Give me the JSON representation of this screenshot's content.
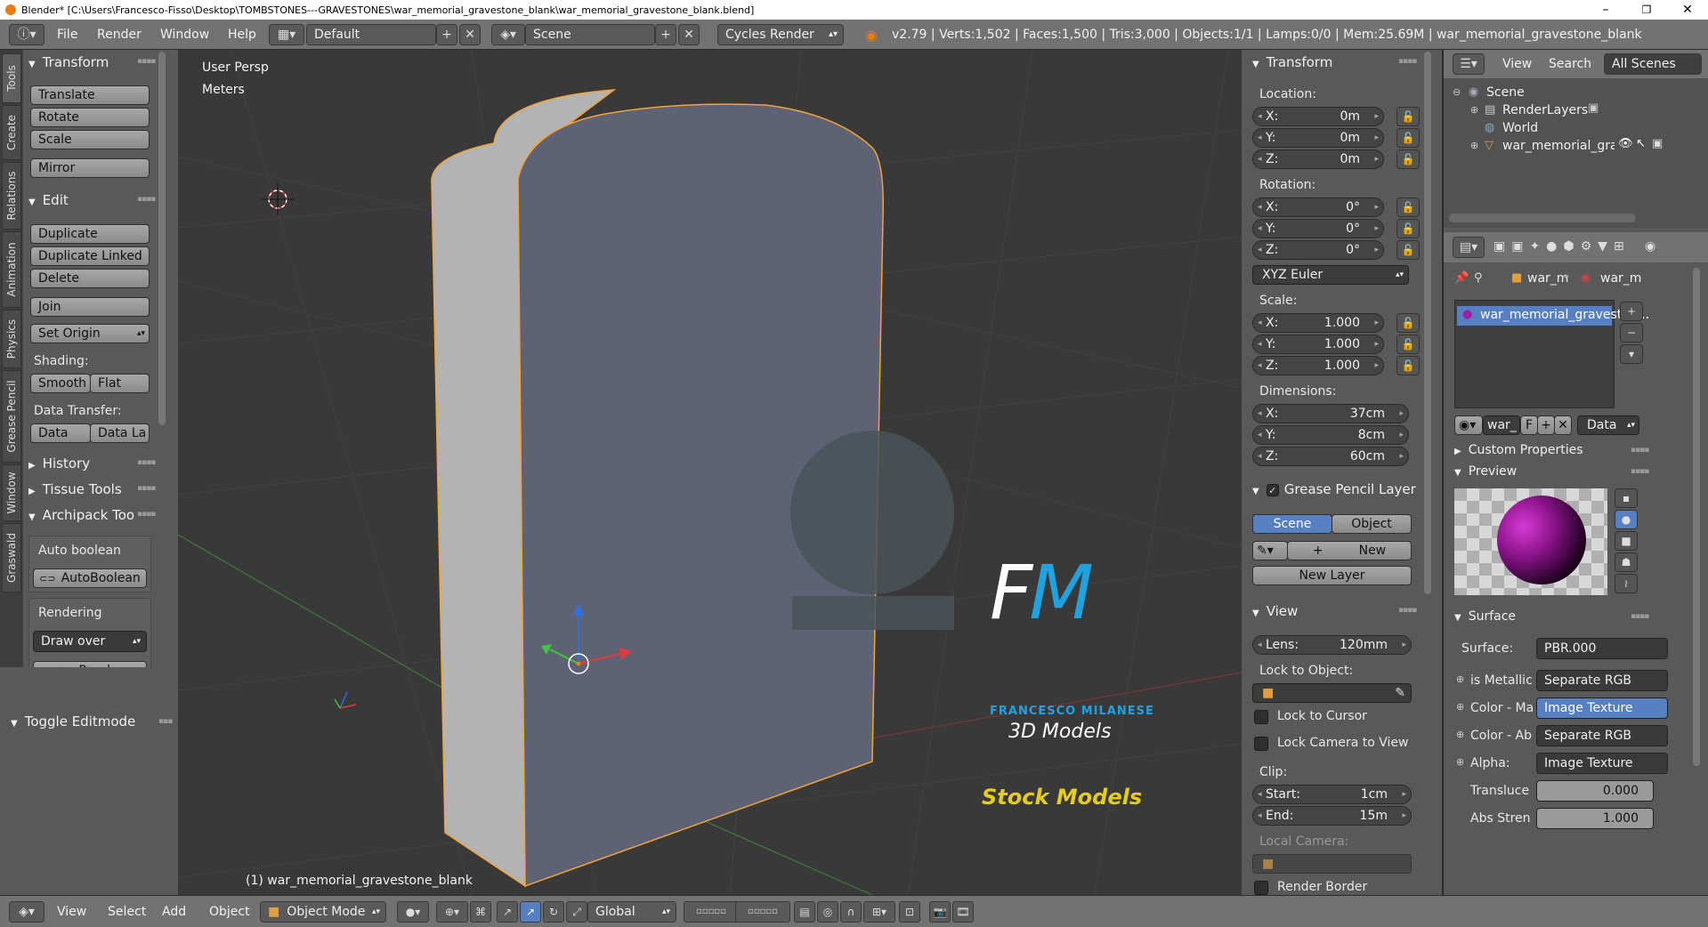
{
  "window": {
    "title": "Blender* [C:\\Users\\Francesco-Fisso\\Desktop\\TOMBSTONES---GRAVESTONES\\war_memorial_gravestone_blank\\war_memorial_gravestone_blank.blend]",
    "minimize": "–",
    "maximize": "❐",
    "close": "✕"
  },
  "info_header": {
    "menus": [
      "File",
      "Render",
      "Window",
      "Help"
    ],
    "screen_layout": "Default",
    "scene": "Scene",
    "render_engine": "Cycles Render",
    "stats": "v2.79 | Verts:1,502 | Faces:1,500 | Tris:3,000 | Objects:1/1 | Lamps:0/0 | Mem:25.69M | war_memorial_gravestone_blank"
  },
  "tool_tabs": [
    "Tools",
    "Create",
    "Relations",
    "Animation",
    "Physics",
    "Grease Pencil",
    "Window",
    "Graswald"
  ],
  "toolshelf": {
    "transform_title": "Transform",
    "translate": "Translate",
    "rotate": "Rotate",
    "scale": "Scale",
    "mirror": "Mirror",
    "edit_title": "Edit",
    "duplicate": "Duplicate",
    "duplicate_linked": "Duplicate Linked",
    "delete": "Delete",
    "join": "Join",
    "set_origin": "Set Origin",
    "shading_label": "Shading:",
    "smooth": "Smooth",
    "flat": "Flat",
    "data_transfer_label": "Data Transfer:",
    "data": "Data",
    "data_layout": "Data La",
    "history": "History",
    "tissue_tools": "Tissue Tools",
    "archipack": "Archipack Too",
    "auto_boolean_label": "Auto boolean",
    "autoboolean_btn": "AutoBoolean",
    "rendering_label": "Rendering",
    "draw_over": "Draw over",
    "render_btn": "Render",
    "toggle_editmode": "Toggle Editmode"
  },
  "viewport": {
    "view_name": "User Persp",
    "units": "Meters",
    "object_label": "(1) war_memorial_gravestone_blank",
    "watermark_letters": "FM",
    "watermark_name": "FRANCESCO MILANESE",
    "watermark_sub": "3D Models",
    "watermark_tag": "Stock Models"
  },
  "npanel": {
    "transform_title": "Transform",
    "location_label": "Location:",
    "location": [
      {
        "axis": "X:",
        "value": "0m"
      },
      {
        "axis": "Y:",
        "value": "0m"
      },
      {
        "axis": "Z:",
        "value": "0m"
      }
    ],
    "rotation_label": "Rotation:",
    "rotation": [
      {
        "axis": "X:",
        "value": "0°"
      },
      {
        "axis": "Y:",
        "value": "0°"
      },
      {
        "axis": "Z:",
        "value": "0°"
      }
    ],
    "rotation_mode": "XYZ Euler",
    "scale_label": "Scale:",
    "scale": [
      {
        "axis": "X:",
        "value": "1.000"
      },
      {
        "axis": "Y:",
        "value": "1.000"
      },
      {
        "axis": "Z:",
        "value": "1.000"
      }
    ],
    "dimensions_label": "Dimensions:",
    "dimensions": [
      {
        "axis": "X:",
        "value": "37cm"
      },
      {
        "axis": "Y:",
        "value": "8cm"
      },
      {
        "axis": "Z:",
        "value": "60cm"
      }
    ],
    "grease_pencil_title": "Grease Pencil Layer",
    "gp_scene": "Scene",
    "gp_object": "Object",
    "gp_new": "New",
    "gp_new_layer": "New Layer",
    "view_title": "View",
    "lens_label": "Lens:",
    "lens_value": "120mm",
    "lock_to_object": "Lock to Object:",
    "lock_to_cursor": "Lock to Cursor",
    "lock_camera": "Lock Camera to View",
    "clip_label": "Clip:",
    "clip_start_label": "Start:",
    "clip_start": "1cm",
    "clip_end_label": "End:",
    "clip_end": "15m",
    "local_camera": "Local Camera:",
    "render_border": "Render Border"
  },
  "outliner": {
    "view": "View",
    "search": "Search",
    "filter": "All Scenes",
    "items": [
      "Scene",
      "RenderLayers",
      "World",
      "war_memorial_gravest"
    ]
  },
  "properties": {
    "breadcrumb_object": "war_m",
    "breadcrumb_material": "war_m",
    "material_slot": "war_memorial_graveston...",
    "material_name": "war_",
    "fake_user": "F",
    "link": "Data",
    "custom_properties": "Custom Properties",
    "preview": "Preview",
    "surface_title": "Surface",
    "surface_label": "Surface:",
    "surface_value": "PBR.000",
    "inputs": [
      {
        "label": "is Metallic",
        "value": "Separate RGB"
      },
      {
        "label": "Color - Ma",
        "value": "Image Texture"
      },
      {
        "label": "Color - Ab",
        "value": "Separate RGB"
      },
      {
        "label": "Alpha:",
        "value": "Image Texture"
      }
    ],
    "translucence_label": "Transluce",
    "translucence_value": "0.000",
    "abs_strength_label": "Abs Stren",
    "abs_strength_value": "1.000"
  },
  "bottom_header": {
    "menus": [
      "View",
      "Select",
      "Add",
      "Object"
    ],
    "mode": "Object Mode",
    "orientation": "Global"
  },
  "colors": {
    "header": "#727272",
    "panel": "#595959",
    "viewport": "#393939",
    "object_face": "#5f6275",
    "selection_outline": "#f2a43a",
    "watermark_blue": "#1fa3e0",
    "watermark_yellow": "#e6cc1e"
  }
}
